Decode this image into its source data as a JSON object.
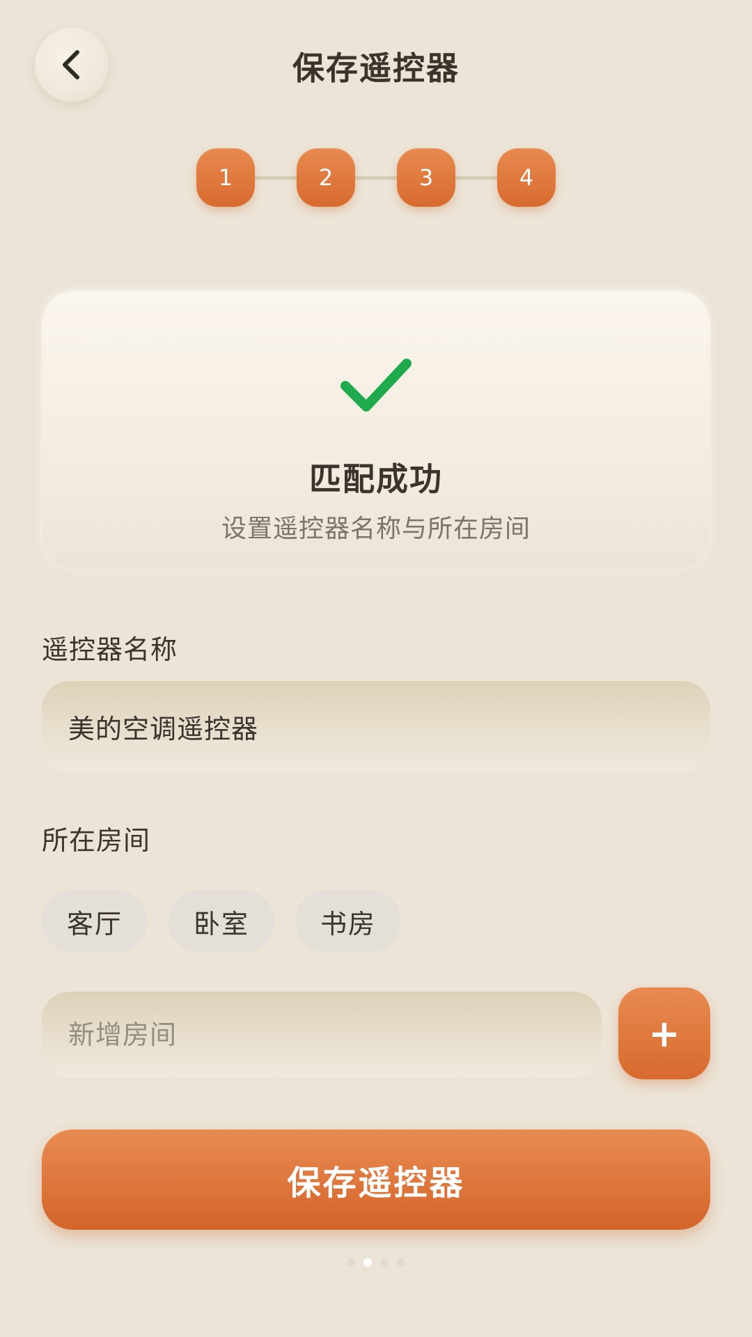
{
  "header": {
    "title": "保存遥控器",
    "back_icon": "chevron-left-icon"
  },
  "stepper": {
    "steps": [
      "1",
      "2",
      "3",
      "4"
    ],
    "current_step": 4
  },
  "success": {
    "icon": "check-icon",
    "title": "匹配成功",
    "subtitle": "设置遥控器名称与所在房间"
  },
  "form": {
    "name_label": "遥控器名称",
    "name_value": "美的空调遥控器",
    "room_label": "所在房间",
    "rooms": [
      "客厅",
      "卧室",
      "书房"
    ],
    "new_room_placeholder": "新增房间",
    "add_label": "+"
  },
  "save_button": "保存遥控器",
  "pager": {
    "count": 4,
    "active": 2
  },
  "colors": {
    "background": "#ece4d7",
    "accent": "#e07a3c",
    "success": "#1faa4e"
  }
}
